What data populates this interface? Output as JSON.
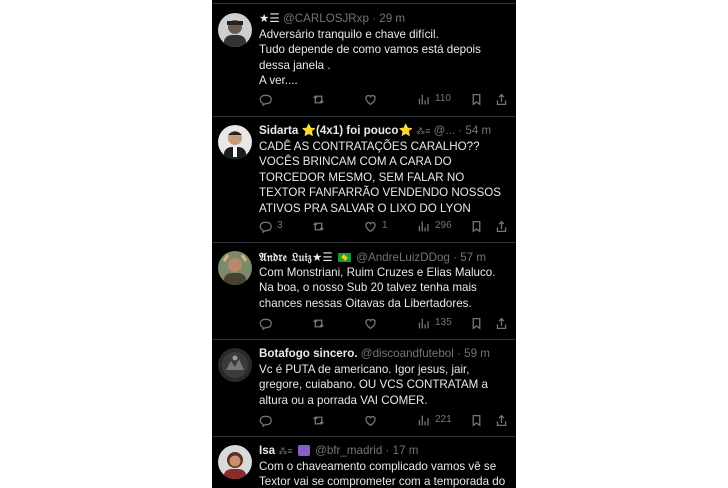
{
  "tweets": [
    {
      "name": "",
      "name_badge": "★☰",
      "handle": "@CARLOSJRxp",
      "time": "29 m",
      "text": "Adversário tranquilo e chave difícil.\nTudo depende de como vamos está depois dessa janela .\nA ver....",
      "replies": "",
      "retweets": "",
      "likes": "",
      "views": "110"
    },
    {
      "name": "Sidarta",
      "name_suffix": "(4x1) foi pouco",
      "handle": "@...",
      "time": "54 m",
      "text": "CADÊ AS CONTRATAÇÕES CARALHO??\nVOCÊS BRINCAM COM A CARA DO TORCEDOR MESMO, SEM FALAR NO TEXTOR FANFARRÃO VENDENDO NOSSOS ATIVOS PRA SALVAR O LIXO DO LYON",
      "replies": "3",
      "retweets": "",
      "likes": "1",
      "views": "296"
    },
    {
      "name": "𝔄𝔫𝔡𝔯𝔢 𝔏𝔲𝔦𝔷",
      "name_badge": "★☰",
      "handle": "@AndreLuizDDog",
      "time": "57 m",
      "text": "Com Monstriani, Ruim Cruzes e Elias Maluco.\nNa boa, o nosso Sub 20 talvez tenha mais chances nessas Oitavas da Libertadores.",
      "replies": "",
      "retweets": "",
      "likes": "",
      "views": "135"
    },
    {
      "name": "Botafogo sincero.",
      "handle": "@discoandfutebol",
      "time": "59 m",
      "text": "Vc é PUTA de americano. Igor jesus, jair, gregore, cuiabano. OU VCS CONTRATAM a altura ou a porrada VAI COMER.",
      "replies": "",
      "retweets": "",
      "likes": "",
      "views": "221"
    },
    {
      "name": "Isa",
      "handle": "@bfr_madrid",
      "time": "17 m",
      "text": "Com o chaveamento complicado vamos vê se Textor vai se comprometer com a temporada do",
      "replies": "",
      "retweets": "",
      "likes": "",
      "views": ""
    }
  ],
  "icons": {
    "reply": "reply-icon",
    "retweet": "retweet-icon",
    "like": "heart-icon",
    "views": "views-icon",
    "bookmark": "bookmark-icon",
    "share": "share-icon"
  },
  "colors": {
    "background": "#000000",
    "text": "#e7e9ea",
    "secondary": "#71767b",
    "divider": "#2f3336",
    "star": "#ffd400"
  }
}
